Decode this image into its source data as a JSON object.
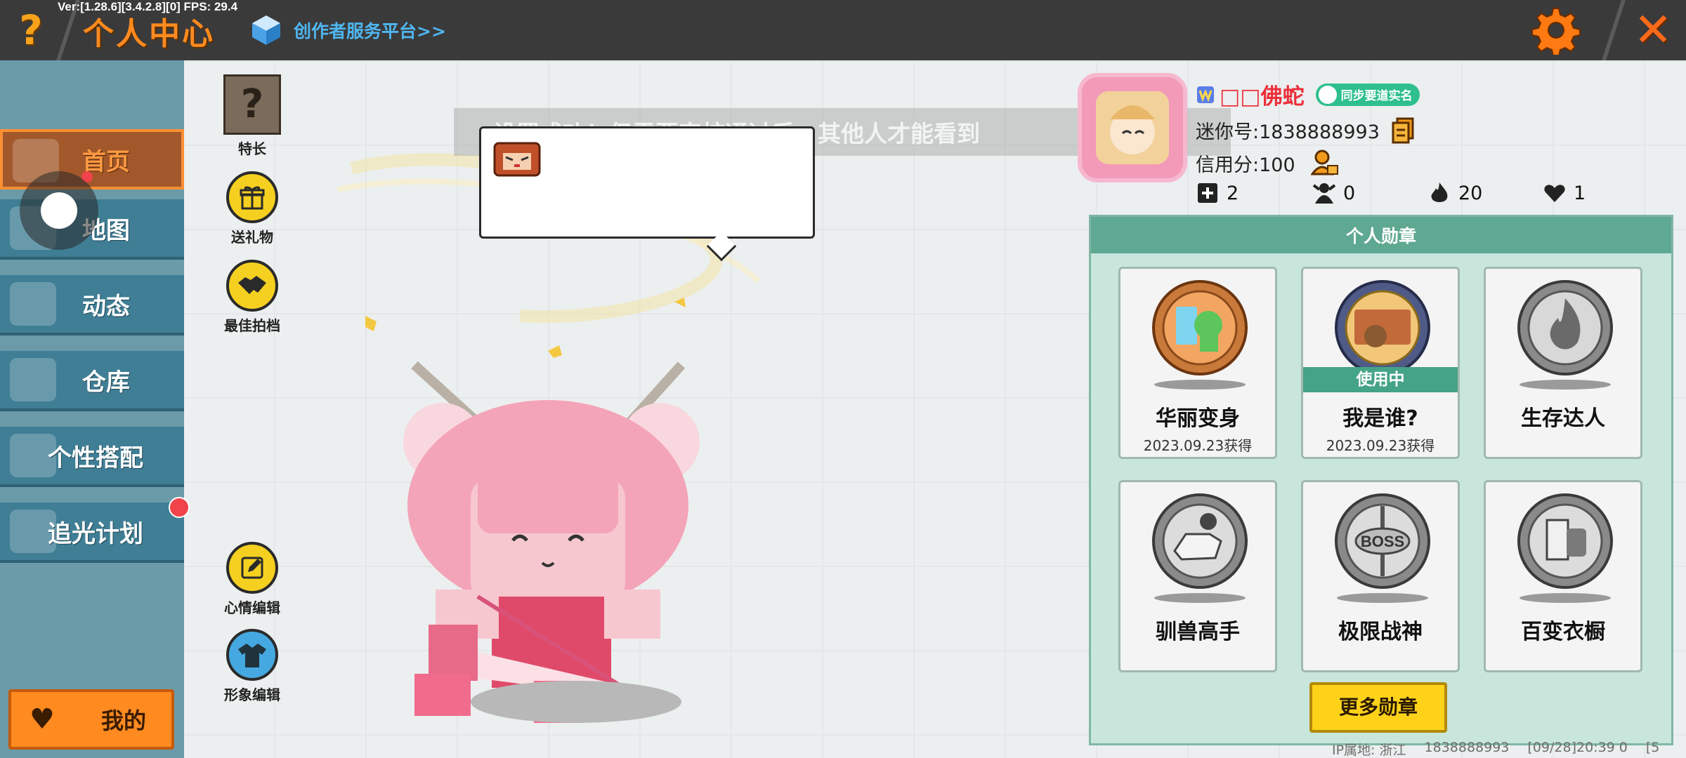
{
  "header": {
    "help_icon": "question-icon",
    "title": "个人中心",
    "version": "Ver:[1.28.6][3.4.2.8][0] FPS: 29.4",
    "creator_link": "创作者服务平台>>",
    "settings_icon": "gear-icon",
    "close_icon": "close-icon",
    "accent": "#ff8a1f"
  },
  "sidebar": {
    "items": [
      {
        "label": "首页",
        "icon": "home-icon",
        "active": true
      },
      {
        "label": "地图",
        "icon": "map-icon",
        "active": false
      },
      {
        "label": "动态",
        "icon": "bell-icon",
        "active": false
      },
      {
        "label": "仓库",
        "icon": "house-icon",
        "active": false
      },
      {
        "label": "个性搭配",
        "icon": "outfit-icon",
        "active": false
      },
      {
        "label": "追光计划",
        "icon": "spotlight-icon",
        "active": false
      }
    ],
    "mine_label": "我的",
    "mine_icon": "heart-icon"
  },
  "actions": {
    "specialty": "特长",
    "specialty_glyph": "?",
    "gift": "送礼物",
    "partner": "最佳拍档",
    "mood_edit": "心情编辑",
    "avatar_edit": "形象编辑"
  },
  "toast": "设置成功！但需要审核通过后，其他人才能看到",
  "profile": {
    "nickname": "□□佛蛇",
    "sync_badge": "同步要道实名",
    "mini_id": "迷你号:1838888993",
    "credit": "信用分:100",
    "stats": [
      {
        "icon": "plus-box-icon",
        "value": "2"
      },
      {
        "icon": "fans-icon",
        "value": "0"
      },
      {
        "icon": "flame-icon",
        "value": "20"
      },
      {
        "icon": "hearts-icon",
        "value": "1"
      }
    ]
  },
  "badges": {
    "title": "个人勋章",
    "in_use_label": "使用中",
    "items": [
      {
        "name": "华丽变身",
        "date": "2023.09.23获得",
        "in_use": false,
        "owned": true
      },
      {
        "name": "我是谁?",
        "date": "2023.09.23获得",
        "in_use": true,
        "owned": true
      },
      {
        "name": "生存达人",
        "date": "",
        "in_use": false,
        "owned": false
      },
      {
        "name": "驯兽高手",
        "date": "",
        "in_use": false,
        "owned": false
      },
      {
        "name": "极限战神",
        "date": "",
        "in_use": false,
        "owned": false
      },
      {
        "name": "百变衣橱",
        "date": "",
        "in_use": false,
        "owned": false
      }
    ],
    "more_label": "更多勋章",
    "boss_text": "BOSS"
  },
  "footer": {
    "ip_location": "IP属地: 浙江",
    "uid": "1838888993",
    "timestamp": "[09/28]20:39 0",
    "extra": "[5"
  }
}
